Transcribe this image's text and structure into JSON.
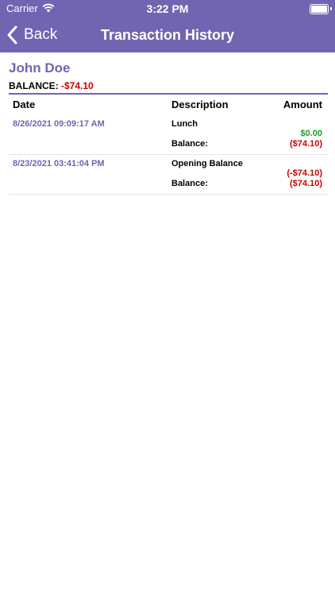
{
  "status_bar": {
    "carrier": "Carrier",
    "time": "3:22 PM"
  },
  "nav": {
    "back_label": "Back",
    "title": "Transaction History"
  },
  "customer": {
    "name": "John Doe",
    "balance_label": "BALANCE:",
    "balance_value": "-$74.10"
  },
  "table": {
    "headers": {
      "date": "Date",
      "description": "Description",
      "amount": "Amount"
    },
    "rows": [
      {
        "date": "8/26/2021 09:09:17 AM",
        "description": "Lunch",
        "amount": "$0.00",
        "balance_label": "Balance:",
        "balance_value": "($74.10)"
      },
      {
        "date": "8/23/2021 03:41:04 PM",
        "description": "Opening Balance",
        "amount": "(-$74.10)",
        "balance_label": "Balance:",
        "balance_value": "($74.10)"
      }
    ]
  },
  "colors": {
    "accent": "#7165b2",
    "negative": "#cc0000",
    "positive": "#229922"
  }
}
